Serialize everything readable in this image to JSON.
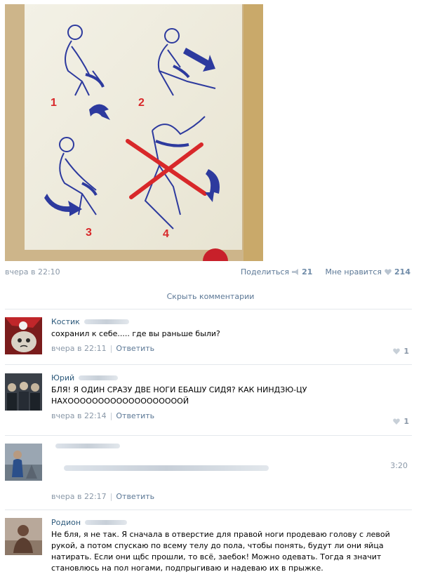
{
  "post": {
    "image_labels": [
      "1",
      "2",
      "3",
      "4"
    ],
    "time": "вчера в 22:10",
    "share_label": "Поделиться",
    "share_count": "21",
    "like_label": "Мне нравится",
    "like_count": "214"
  },
  "hide_comments": "Скрыть комментарии",
  "comments": [
    {
      "name": "Костик",
      "text": "сохранил к себе..... где вы раньше были?",
      "time": "вчера в 22:11",
      "reply": "Ответить",
      "likes": "1"
    },
    {
      "name": "Юрий",
      "text": "БЛЯ! Я ОДИН СРАЗУ ДВЕ НОГИ ЕБАШУ СИДЯ? КАК НИНДЗЮ-ЦУ НАХОООООООООООООООООООЙ",
      "time": "вчера в 22:14",
      "reply": "Ответить",
      "likes": "1"
    },
    {
      "name": "",
      "duration": "3:20",
      "time": "вчера в 22:17",
      "reply": "Ответить"
    },
    {
      "name": "Родион",
      "text": "Не бля, я не так. Я сначала в отверстие для правой ноги продеваю голову с левой рукой, а потом спускаю по всему телу до пола, чтобы понять, будут ли они яйца натирать. Если они щбс прошли, то всё, заебок! Можно одевать. Тогда я значит становлюсь на пол ногами, подпрыгиваю и надеваю их в прыжке."
    }
  ],
  "colors": {
    "link": "#2b587a",
    "muted": "#8a98a8",
    "arrow": "#2d3a9e",
    "cross": "#d8282a"
  }
}
